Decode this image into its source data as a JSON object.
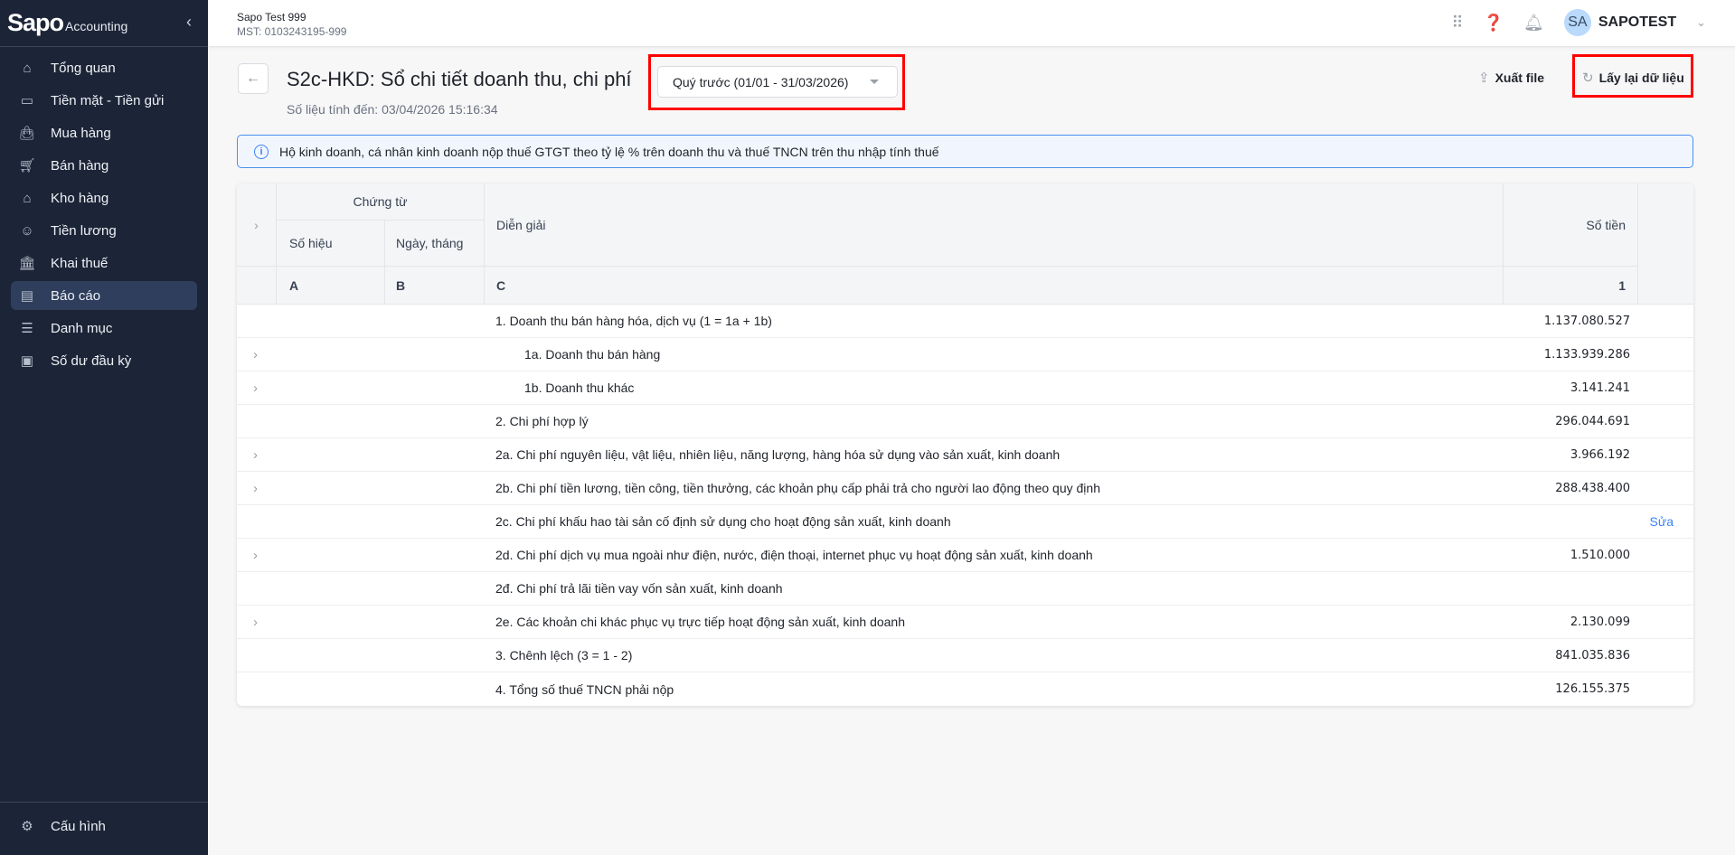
{
  "sidebar": {
    "brand": "Sapo",
    "brand_sub": "Accounting",
    "items": [
      {
        "label": "Tổng quan",
        "icon": "home-icon"
      },
      {
        "label": "Tiền mặt - Tiền gửi",
        "icon": "cash-icon"
      },
      {
        "label": "Mua hàng",
        "icon": "bag-icon"
      },
      {
        "label": "Bán hàng",
        "icon": "cart-icon"
      },
      {
        "label": "Kho hàng",
        "icon": "warehouse-icon"
      },
      {
        "label": "Tiền lương",
        "icon": "salary-icon"
      },
      {
        "label": "Khai thuế",
        "icon": "bank-icon"
      },
      {
        "label": "Báo cáo",
        "icon": "report-icon",
        "active": true
      },
      {
        "label": "Danh mục",
        "icon": "list-icon"
      },
      {
        "label": "Số dư đầu kỳ",
        "icon": "wallet-icon"
      }
    ],
    "settings": "Cấu hình"
  },
  "header": {
    "company": "Sapo Test 999",
    "mst": "MST: 0103243195-999",
    "avatar": "SA",
    "user": "SAPOTEST"
  },
  "page": {
    "title": "S2c-HKD: Sổ chi tiết doanh thu, chi phí",
    "subtitle": "Số liệu tính đến: 03/04/2026 15:16:34",
    "period": "Quý trước (01/01 - 31/03/2026)",
    "export": "Xuất file",
    "refresh": "Lấy lại dữ liệu"
  },
  "info": "Hộ kinh doanh, cá nhân kinh doanh nộp thuế GTGT theo tỷ lệ % trên doanh thu và thuế TNCN trên thu nhập tính thuế",
  "colors": {
    "sidebar_bg": "#1c2537",
    "accent": "#3b82f6",
    "highlight": "#ff0000"
  },
  "table": {
    "headers": {
      "voucher": "Chứng từ",
      "number": "Số hiệu",
      "date": "Ngày, tháng",
      "desc": "Diễn giải",
      "amount": "Số tiền",
      "col_a": "A",
      "col_b": "B",
      "col_c": "C",
      "col_1": "1"
    },
    "rows": [
      {
        "desc": "1. Doanh thu bán hàng hóa, dịch vụ (1 = 1a + 1b)",
        "amount": "1.137.080.527",
        "expand": false,
        "indent": false
      },
      {
        "desc": "1a. Doanh thu bán hàng",
        "amount": "1.133.939.286",
        "expand": true,
        "indent": true
      },
      {
        "desc": "1b. Doanh thu khác",
        "amount": "3.141.241",
        "expand": true,
        "indent": true
      },
      {
        "desc": "2. Chi phí hợp lý",
        "amount": "296.044.691",
        "expand": false,
        "indent": false
      },
      {
        "desc": "2a. Chi phí nguyên liệu, vật liệu, nhiên liệu, năng lượng, hàng hóa sử dụng vào sản xuất, kinh doanh",
        "amount": "3.966.192",
        "expand": true,
        "indent": false
      },
      {
        "desc": "2b. Chi phí tiền lương, tiền công, tiền thưởng, các khoản phụ cấp phải trả cho người lao động theo quy định",
        "amount": "288.438.400",
        "expand": true,
        "indent": false
      },
      {
        "desc": "2c. Chi phí khấu hao tài sản cố định sử dụng cho hoạt động sản xuất, kinh doanh",
        "amount": "",
        "expand": false,
        "indent": false,
        "action": "Sửa"
      },
      {
        "desc": "2d. Chi phí dịch vụ mua ngoài như điện, nước, điện thoại, internet phục vụ hoạt động sản xuất, kinh doanh",
        "amount": "1.510.000",
        "expand": true,
        "indent": false
      },
      {
        "desc": "2đ. Chi phí trả lãi tiền vay vốn sản xuất, kinh doanh",
        "amount": "",
        "expand": false,
        "indent": false
      },
      {
        "desc": "2e. Các khoản chi khác phục vụ trực tiếp hoạt động sản xuất, kinh doanh",
        "amount": "2.130.099",
        "expand": true,
        "indent": false
      },
      {
        "desc": "3. Chênh lệch (3 = 1 - 2)",
        "amount": "841.035.836",
        "expand": false,
        "indent": false
      },
      {
        "desc": "4. Tổng số thuế TNCN phải nộp",
        "amount": "126.155.375",
        "expand": false,
        "indent": false
      }
    ]
  }
}
